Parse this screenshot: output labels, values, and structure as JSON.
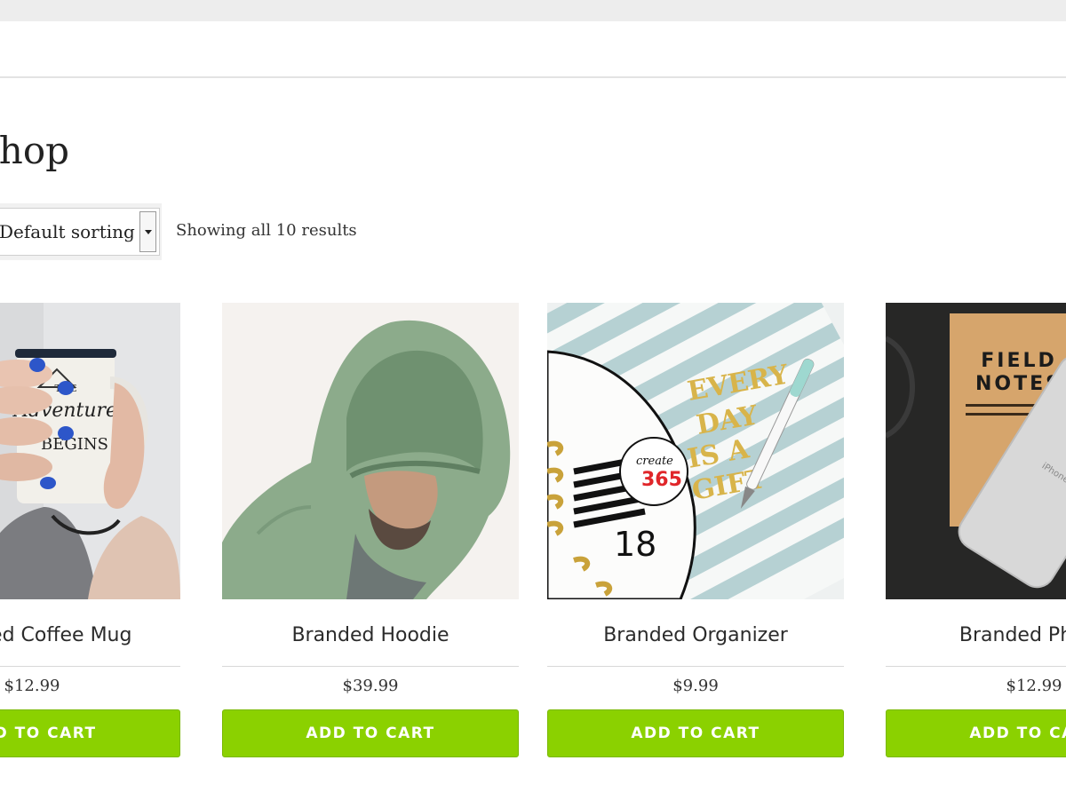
{
  "header": {
    "page_title": "Shop"
  },
  "toolbar": {
    "sort_selected": "Default sorting",
    "result_count": "Showing all 10 results"
  },
  "products": [
    {
      "name": "Branded Coffee Mug",
      "price": "$12.99",
      "button": "ADD TO CART",
      "image_text": [
        "THE",
        "Adventure",
        "BEGINS"
      ]
    },
    {
      "name": "Branded Hoodie",
      "price": "$39.99",
      "button": "ADD TO CART"
    },
    {
      "name": "Branded Organizer",
      "price": "$9.99",
      "button": "ADD TO CART",
      "image_text": [
        "EVERY",
        "DAY",
        "IS A",
        "GIFT",
        "create",
        "365",
        "18"
      ]
    },
    {
      "name": "Branded Phone",
      "price": "$12.99",
      "button": "ADD TO CART",
      "image_text": [
        "FIELD",
        "NOTES",
        "iPhone"
      ]
    }
  ],
  "colors": {
    "button": "#8bd100",
    "top_strip": "#ededed"
  }
}
